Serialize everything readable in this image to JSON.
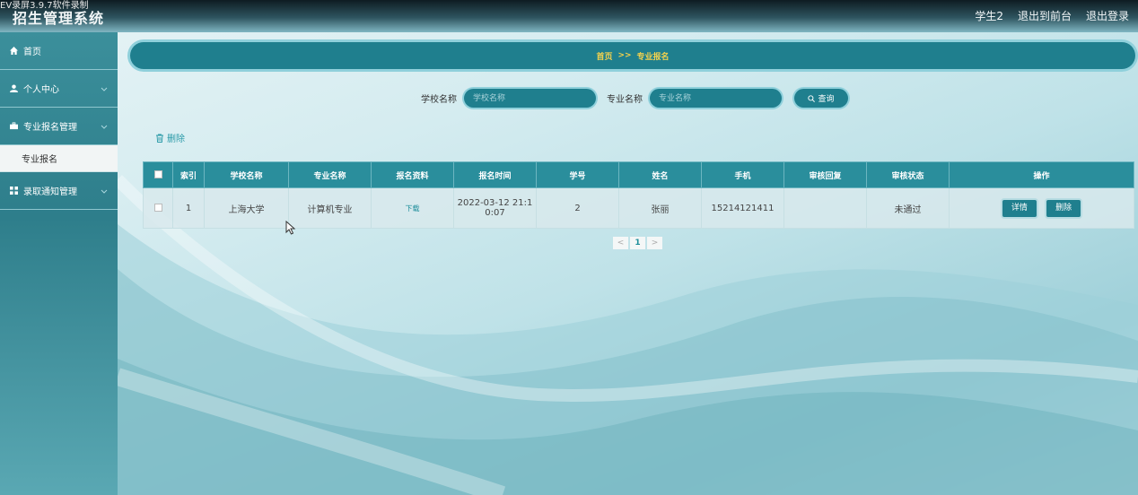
{
  "recording_overlay": "EV录屏3.9.7软件录制",
  "app_title": "招生管理系统",
  "top_links": [
    "学生2",
    "退出到前台",
    "退出登录"
  ],
  "sidebar": {
    "items": [
      {
        "label": "首页",
        "icon": "home-icon"
      },
      {
        "label": "个人中心",
        "icon": "user-icon"
      },
      {
        "label": "专业报名管理",
        "icon": "briefcase-icon"
      },
      {
        "label": "录取通知管理",
        "icon": "grid-icon"
      }
    ],
    "submenu": {
      "label": "专业报名"
    }
  },
  "breadcrumb": {
    "home": "首页",
    "sep": ">>",
    "current": "专业报名"
  },
  "search": {
    "school_label": "学校名称",
    "school_placeholder": "学校名称",
    "major_label": "专业名称",
    "major_placeholder": "专业名称",
    "button_label": "查询"
  },
  "delete_label": "删除",
  "table": {
    "headers": [
      "索引",
      "学校名称",
      "专业名称",
      "报名资料",
      "报名时间",
      "学号",
      "姓名",
      "手机",
      "审核回复",
      "审核状态",
      "操作"
    ],
    "rows": [
      {
        "index": "1",
        "school": "上海大学",
        "major": "计算机专业",
        "material": "下载",
        "time_line1": "2022-03-12 21:1",
        "time_line2": "0:07",
        "student_no": "2",
        "name": "张丽",
        "phone": "15214121411",
        "reply": "",
        "status": "未通过",
        "detail_label": "详情",
        "delete_label": "删除"
      }
    ]
  },
  "pager": {
    "prev": "<",
    "page": "1",
    "next": ">"
  },
  "colors": {
    "primary": "#1f7f8e",
    "accent": "#f4d24d",
    "sidebar": "#2e7e8b"
  }
}
